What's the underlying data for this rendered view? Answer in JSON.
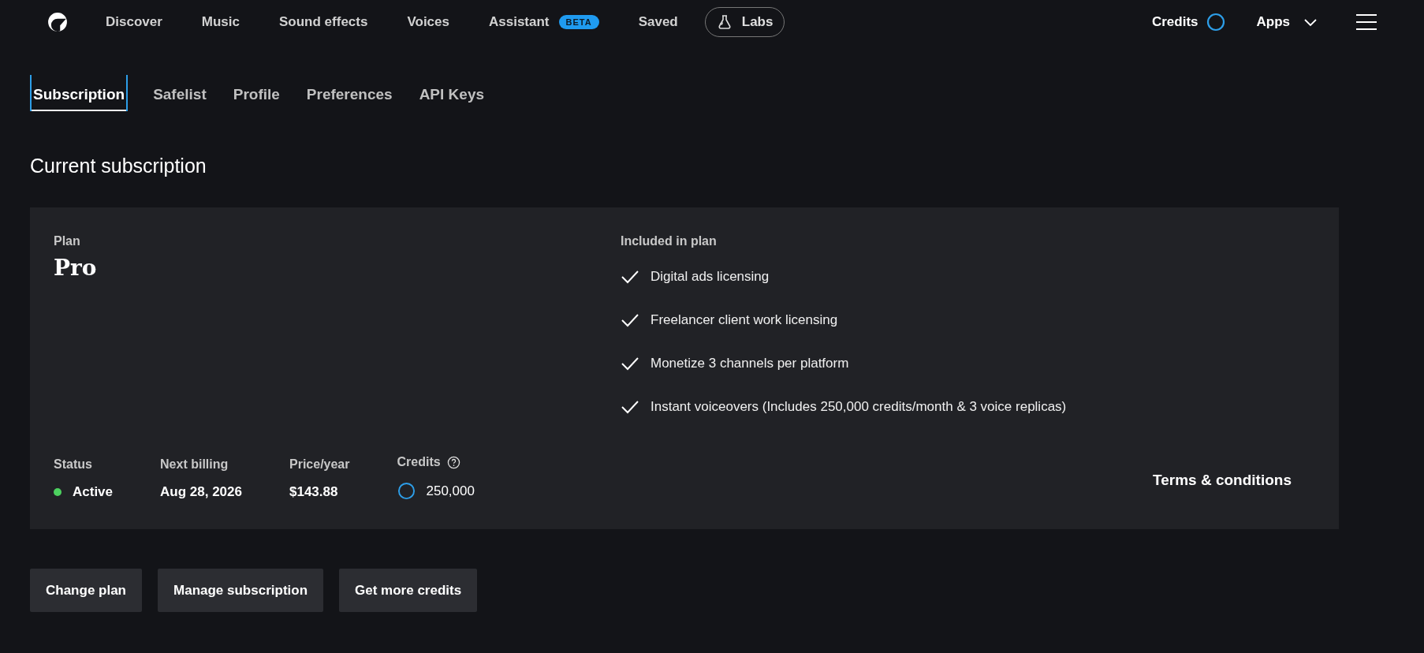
{
  "nav": {
    "items": [
      {
        "label": "Discover"
      },
      {
        "label": "Music"
      },
      {
        "label": "Sound effects"
      },
      {
        "label": "Voices"
      },
      {
        "label": "Assistant",
        "badge": "BETA"
      },
      {
        "label": "Saved"
      }
    ],
    "labs": "Labs",
    "credits": "Credits",
    "apps": "Apps"
  },
  "tabs": [
    {
      "label": "Subscription",
      "selected": true
    },
    {
      "label": "Safelist",
      "selected": false
    },
    {
      "label": "Profile",
      "selected": false
    },
    {
      "label": "Preferences",
      "selected": false
    },
    {
      "label": "API Keys",
      "selected": false
    }
  ],
  "heading": "Current subscription",
  "card": {
    "plan_label": "Plan",
    "plan": "Pro",
    "included_label": "Included in plan",
    "features": [
      "Digital ads licensing",
      "Freelancer client work licensing",
      "Monetize 3 channels per platform",
      "Instant voiceovers (Includes 250,000 credits/month & 3 voice replicas)"
    ],
    "status": {
      "label": "Status",
      "value": "Active",
      "color": "#4cd15f"
    },
    "next_billing": {
      "label": "Next billing",
      "value": "Aug 28, 2026"
    },
    "price": {
      "label": "Price/year",
      "value": "$143.88"
    },
    "credits": {
      "label": "Credits",
      "value": "250,000"
    },
    "terms": "Terms & conditions"
  },
  "buttons": [
    "Change plan",
    "Manage subscription",
    "Get more credits"
  ]
}
